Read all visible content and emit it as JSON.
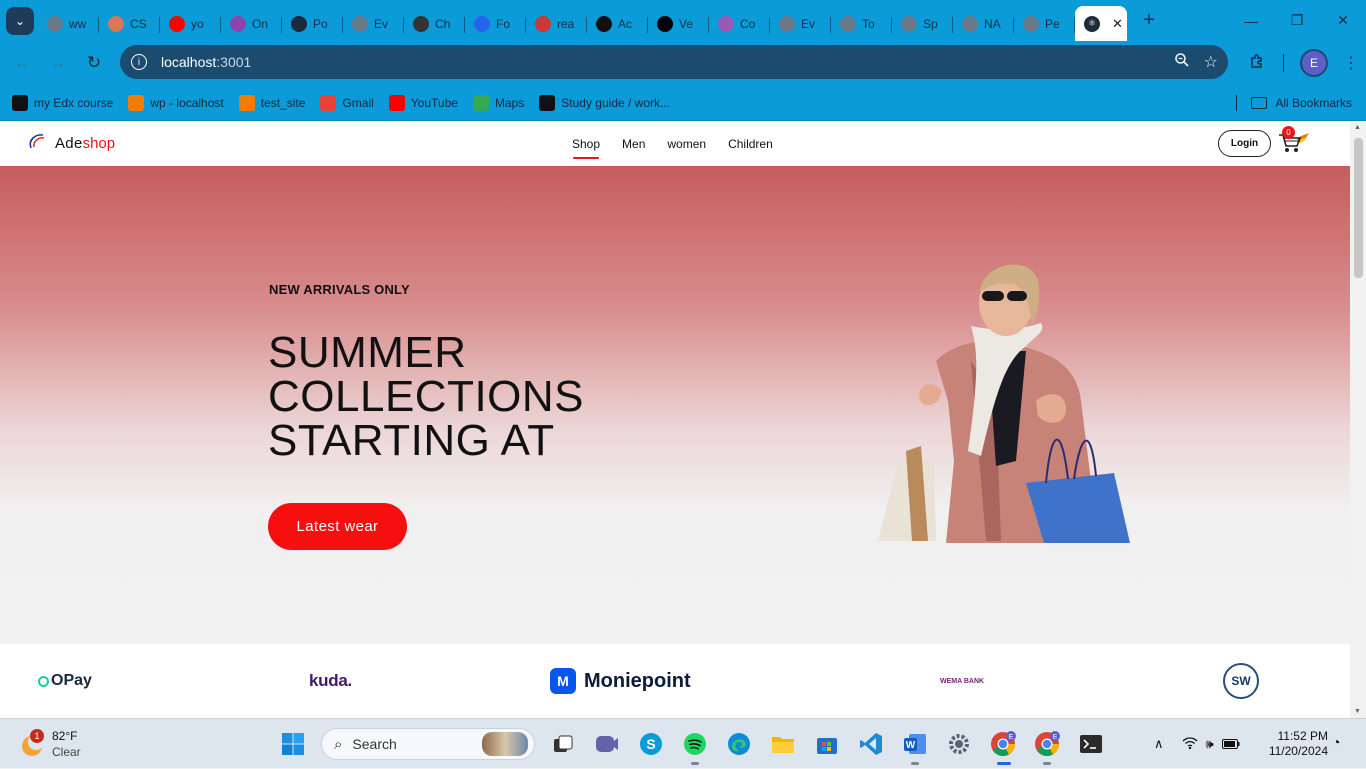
{
  "browser": {
    "tabs": [
      {
        "label": "ww",
        "icon": "globe-icon",
        "color": "#6a7a8a"
      },
      {
        "label": "CS",
        "icon": "claude-icon",
        "color": "#d97757"
      },
      {
        "label": "yo",
        "icon": "youtube-icon",
        "color": "#ff0000"
      },
      {
        "label": "On",
        "icon": "notion-calendar-icon",
        "color": "#8e44ad"
      },
      {
        "label": "Po",
        "icon": "react-icon",
        "color": "#1b2b3a"
      },
      {
        "label": "Ev",
        "icon": "globe-icon",
        "color": "#6a7a8a"
      },
      {
        "label": "Ch",
        "icon": "chatgpt-icon",
        "color": "#333333"
      },
      {
        "label": "Fo",
        "icon": "flag-icon",
        "color": "#2563eb"
      },
      {
        "label": "rea",
        "icon": "npm-icon",
        "color": "#cb3837"
      },
      {
        "label": "Ac",
        "icon": "github-icon",
        "color": "#111111"
      },
      {
        "label": "Ve",
        "icon": "vercel-icon",
        "color": "#000000"
      },
      {
        "label": "Co",
        "icon": "chart-icon",
        "color": "#9b59b6"
      },
      {
        "label": "Ev",
        "icon": "globe-icon",
        "color": "#6a7a8a"
      },
      {
        "label": "To",
        "icon": "globe-icon",
        "color": "#6a7a8a"
      },
      {
        "label": "Sp",
        "icon": "globe-icon",
        "color": "#6a7a8a"
      },
      {
        "label": "NA",
        "icon": "globe-icon",
        "color": "#6a7a8a"
      },
      {
        "label": "Pe",
        "icon": "globe-icon",
        "color": "#6a7a8a"
      }
    ],
    "active_tab": {
      "icon": "react-icon",
      "close": "✕"
    },
    "new_tab": "+",
    "window_controls": {
      "minimize": "—",
      "maximize": "❐",
      "close": "✕"
    },
    "address": {
      "host": "localhost",
      "port": ":3001"
    },
    "profile_initial": "E",
    "bookmarks": [
      {
        "label": "my Edx course",
        "icon": "edx-icon",
        "color": "#111111"
      },
      {
        "label": "wp - localhost",
        "icon": "xampp-icon",
        "color": "#f57c00"
      },
      {
        "label": "test_site",
        "icon": "xampp-icon",
        "color": "#f57c00"
      },
      {
        "label": "Gmail",
        "icon": "gmail-icon",
        "color": "#ea4335"
      },
      {
        "label": "YouTube",
        "icon": "youtube-icon",
        "color": "#ff0000"
      },
      {
        "label": "Maps",
        "icon": "maps-icon",
        "color": "#34a853"
      },
      {
        "label": "Study guide / work...",
        "icon": "library-icon",
        "color": "#111111"
      }
    ],
    "all_bookmarks": "All Bookmarks"
  },
  "site": {
    "brand": {
      "part1": "Ade",
      "part2": "shop"
    },
    "nav": [
      "Shop",
      "Men",
      "women",
      "Children"
    ],
    "active_nav": "Shop",
    "login_label": "Login",
    "cart_count": "0",
    "hero": {
      "eyebrow": "NEW ARRIVALS ONLY",
      "headline": [
        "SUMMER",
        "COLLECTIONS",
        "STARTING AT"
      ],
      "cta": "Latest wear"
    },
    "partners": [
      "OPay",
      "kuda.",
      "Moniepoint",
      "WEMA BANK",
      "SW"
    ],
    "accent_color": "#e8151b"
  },
  "taskbar": {
    "weather": {
      "temp": "82°F",
      "condition": "Clear",
      "alert_count": "1"
    },
    "search_placeholder": "Search",
    "apps": [
      "start-icon",
      "search",
      "task-view-icon",
      "teams-icon",
      "skype-icon",
      "spotify-icon",
      "edge-icon",
      "file-explorer-icon",
      "store-icon",
      "vscode-icon",
      "word-icon",
      "settings-icon",
      "chrome-icon",
      "chrome-profile-icon",
      "terminal-icon"
    ],
    "time": "11:52 PM",
    "date": "11/20/2024"
  }
}
